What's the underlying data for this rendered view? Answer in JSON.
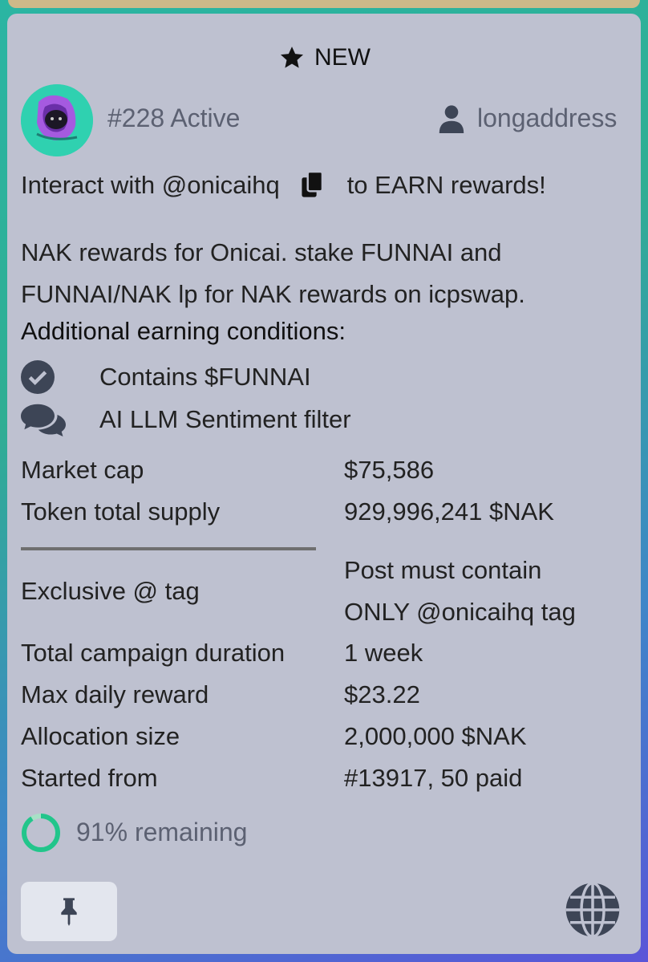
{
  "badge": {
    "label": "NEW",
    "icon": "star-icon"
  },
  "campaign": {
    "id_status": "#228 Active",
    "username": "longaddress",
    "interact_prefix": "Interact with @onicaihq",
    "interact_suffix": "to EARN rewards!",
    "description_line1": "NAK rewards for Onicai. stake FUNNAI and",
    "description_line2": "FUNNAI/NAK lp for NAK rewards on icpswap."
  },
  "conditions": {
    "title": "Additional earning conditions:",
    "items": [
      {
        "icon": "check-circle-icon",
        "label": "Contains $FUNNAI"
      },
      {
        "icon": "comments-icon",
        "label": "AI LLM Sentiment filter"
      }
    ]
  },
  "stats_top": [
    {
      "label": "Market cap",
      "value": "$75,586"
    },
    {
      "label": "Token total supply",
      "value": "929,996,241 $NAK"
    }
  ],
  "exclusive": {
    "label": "Exclusive @ tag",
    "value_line1": "Post must contain",
    "value_line2": "ONLY @onicaihq tag"
  },
  "stats_bottom": [
    {
      "label": "Total campaign duration",
      "value": "1 week"
    },
    {
      "label": "Max daily reward",
      "value": "$23.22"
    },
    {
      "label": "Allocation size",
      "value": "2,000,000 $NAK"
    },
    {
      "label": "Started from",
      "value": "#13917, 50 paid"
    }
  ],
  "progress": {
    "remaining_fraction": 0.91,
    "label": "91% remaining"
  },
  "colors": {
    "card_bg": "#bec1d0",
    "muted_text": "#5c6172",
    "icon_dark": "#3d4556",
    "progress": "#22c58b",
    "progress_track": "#a8e0c6"
  },
  "footer": {
    "pin_icon": "pin-icon",
    "globe_icon": "globe-icon"
  }
}
